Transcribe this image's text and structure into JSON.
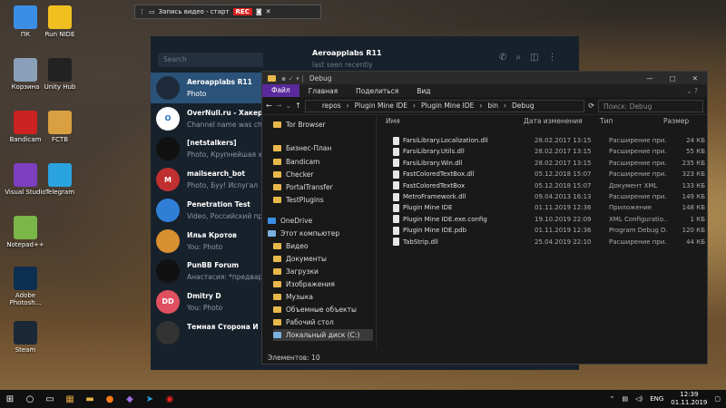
{
  "desktop": {
    "icons": [
      {
        "label": "ПК",
        "icon": "pc-icon",
        "color": "#3a8ee6"
      },
      {
        "label": "Run NIDE",
        "icon": "nide-icon",
        "color": "#f0c020"
      },
      {
        "label": "Корзина",
        "icon": "recycle-bin-icon",
        "color": "#8aa0b8"
      },
      {
        "label": "Unity Hub",
        "icon": "unity-icon",
        "color": "#222"
      },
      {
        "label": "Bandicam",
        "icon": "bandicam-icon",
        "color": "#c22"
      },
      {
        "label": "FCTB",
        "icon": "fctb-icon",
        "color": "#d8a040"
      },
      {
        "label": "Visual Studio",
        "icon": "visual-studio-icon",
        "color": "#7b3fbf"
      },
      {
        "label": "Telegram",
        "icon": "telegram-icon",
        "color": "#2aa3e0"
      },
      {
        "label": "Notepad++",
        "icon": "notepadpp-icon",
        "color": "#7ab648"
      },
      {
        "label": "Adobe Photosh...",
        "icon": "photoshop-icon",
        "color": "#0c2f4f"
      },
      {
        "label": "Steam",
        "icon": "steam-icon",
        "color": "#1b2838"
      }
    ]
  },
  "recorder": {
    "title": "Запись видео - старт",
    "rec": "REC"
  },
  "telegram": {
    "search_placeholder": "Search",
    "contact_name": "Aeroapplabs R11",
    "contact_status": "last seen recently",
    "chats": [
      {
        "name": "Aeroapplabs R11",
        "preview": "Photo",
        "avatar_color": "#1d2b3c",
        "initials": ""
      },
      {
        "name": "OverNull.ru - Хакер",
        "preview": "Channel name was chan",
        "avatar_color": "#ffffff",
        "initials": "O"
      },
      {
        "name": "[netstalkers]",
        "preview": "Photo, Крупнейшая хра",
        "avatar_color": "#111",
        "initials": ""
      },
      {
        "name": "mailsearch_bot",
        "preview": "Photo, Буу! Испугал",
        "avatar_color": "#c03030",
        "initials": "M"
      },
      {
        "name": "Penetration Test",
        "preview": "Video, Российский про",
        "avatar_color": "#2f7fd6",
        "initials": ""
      },
      {
        "name": "Илья Кротов",
        "preview": "You: Photo",
        "preview_sender": "",
        "avatar_color": "#d89030",
        "initials": ""
      },
      {
        "name": "PunBB Forum",
        "preview": "Анастасия: *предварит",
        "avatar_color": "#111",
        "initials": ""
      },
      {
        "name": "Dmitry D",
        "preview": "You: Photo",
        "avatar_color": "#e05060",
        "initials": "DD"
      },
      {
        "name": "Темная Сторона И",
        "preview": "",
        "avatar_color": "#333",
        "initials": ""
      }
    ]
  },
  "explorer": {
    "title": "Debug",
    "ribbon": [
      "Файл",
      "Главная",
      "Поделиться",
      "Вид"
    ],
    "breadcrumb": [
      "repos",
      "Plugin Mine IDE",
      "Plugin Mine IDE",
      "bin",
      "Debug"
    ],
    "search_placeholder": "Поиск: Debug",
    "nav": [
      "Tor Browser",
      "Бизнес-План",
      "Bandicam",
      "Checker",
      "PortalTransfer",
      "TestPlugins",
      "OneDrive",
      "Этот компьютер",
      "Видео",
      "Документы",
      "Загрузки",
      "Изображения",
      "Музыка",
      "Объемные объекты",
      "Рабочий стол",
      "Локальный диск (C:)"
    ],
    "columns": [
      "Имя",
      "Дата изменения",
      "Тип",
      "Размер"
    ],
    "files": [
      {
        "name": "FarsiLibrary.Localization.dll",
        "date": "28.02.2017 13:15",
        "type": "Расширение при...",
        "size": "24 КБ"
      },
      {
        "name": "FarsiLibrary.Utils.dll",
        "date": "28.02.2017 13:15",
        "type": "Расширение при...",
        "size": "55 КБ"
      },
      {
        "name": "FarsiLibrary.Win.dll",
        "date": "28.02.2017 13:15",
        "type": "Расширение при...",
        "size": "235 КБ"
      },
      {
        "name": "FastColoredTextBox.dll",
        "date": "05.12.2018 15:07",
        "type": "Расширение при...",
        "size": "323 КБ"
      },
      {
        "name": "FastColoredTextBox",
        "date": "05.12.2018 15:07",
        "type": "Документ XML",
        "size": "133 КБ"
      },
      {
        "name": "MetroFramework.dll",
        "date": "09.04.2013 16:13",
        "type": "Расширение при...",
        "size": "149 КБ"
      },
      {
        "name": "Plugin Mine IDE",
        "date": "01.11.2019 12:36",
        "type": "Приложение",
        "size": "148 КБ"
      },
      {
        "name": "Plugin Mine IDE.exe.config",
        "date": "19.10.2019 22:09",
        "type": "XML Configuratio...",
        "size": "1 КБ"
      },
      {
        "name": "Plugin Mine IDE.pdb",
        "date": "01.11.2019 12:36",
        "type": "Program Debug D...",
        "size": "120 КБ"
      },
      {
        "name": "TabStrip.dll",
        "date": "25.04.2019 22:10",
        "type": "Расширение при...",
        "size": "44 КБ"
      }
    ],
    "status": "Элементов: 10"
  },
  "taskbar": {
    "lang": "ENG",
    "time": "12:39",
    "date": "01.11.2019"
  }
}
